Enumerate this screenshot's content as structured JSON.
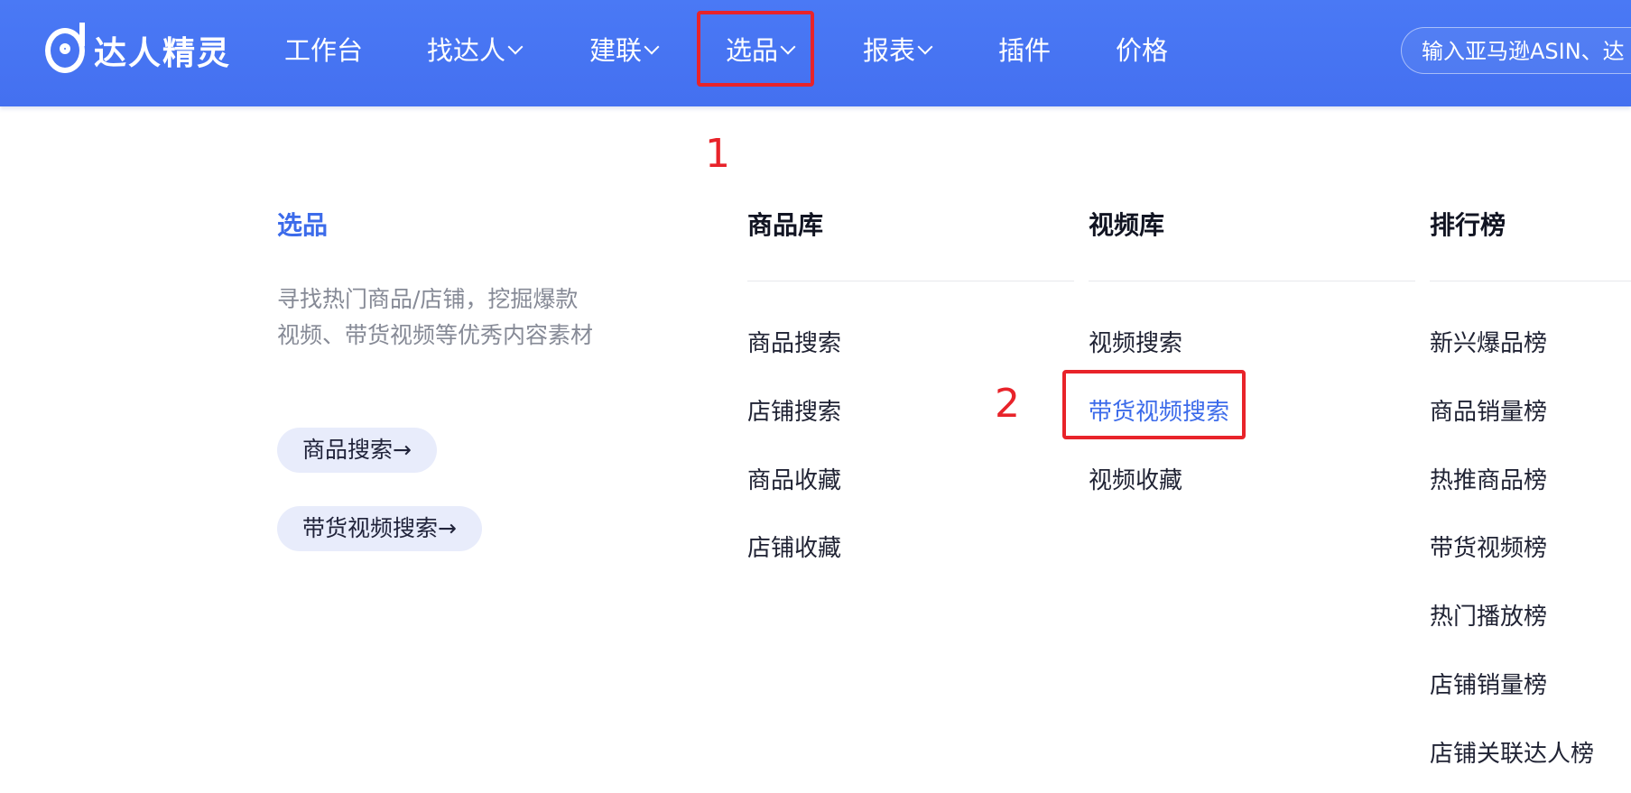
{
  "brand": {
    "name": "达人精灵",
    "icon": "logo-icon"
  },
  "nav": {
    "items": [
      {
        "label": "工作台",
        "dropdown": false
      },
      {
        "label": "找达人",
        "dropdown": true
      },
      {
        "label": "建联",
        "dropdown": true
      },
      {
        "label": "选品",
        "dropdown": true
      },
      {
        "label": "报表",
        "dropdown": true
      },
      {
        "label": "插件",
        "dropdown": false
      },
      {
        "label": "价格",
        "dropdown": false
      }
    ]
  },
  "search": {
    "placeholder": "输入亚马逊ASIN、达"
  },
  "annotations": {
    "step1": "1",
    "step2": "2",
    "color": "#e8232a"
  },
  "menu": {
    "intro": {
      "title": "选品",
      "description": "寻找热门商品/店铺，挖掘爆款视频、带货视频等优秀内容素材",
      "quick_links": [
        "商品搜索→",
        "带货视频搜索→"
      ]
    },
    "columns": [
      {
        "title": "商品库",
        "items": [
          "商品搜索",
          "店铺搜索",
          "商品收藏",
          "店铺收藏"
        ]
      },
      {
        "title": "视频库",
        "items": [
          "视频搜索",
          "带货视频搜索",
          "视频收藏"
        ]
      },
      {
        "title": "排行榜",
        "items": [
          "新兴爆品榜",
          "商品销量榜",
          "热推商品榜",
          "带货视频榜",
          "热门播放榜",
          "店铺销量榜",
          "店铺关联达人榜"
        ]
      }
    ]
  },
  "colors": {
    "accent": "#3c6bea",
    "header": "#4a79f5",
    "pill_bg": "#e8ecfb"
  }
}
